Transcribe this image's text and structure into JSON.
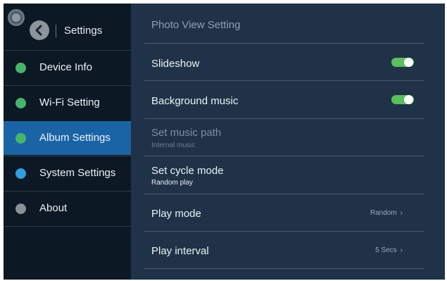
{
  "sidebar": {
    "title": "Settings",
    "items": [
      {
        "label": "Device Info",
        "icon": "info-green-icon",
        "color": "#46b56b",
        "active": false
      },
      {
        "label": "Wi-Fi Setting",
        "icon": "wifi-icon",
        "color": "#46b56b",
        "active": false
      },
      {
        "label": "Album Settings",
        "icon": "album-icon",
        "color": "#46b56b",
        "active": true
      },
      {
        "label": "System Settings",
        "icon": "system-icon",
        "color": "#2f9fe0",
        "active": false
      },
      {
        "label": "About",
        "icon": "about-icon",
        "color": "#8a9096",
        "active": false
      }
    ]
  },
  "main": {
    "title": "Photo View Setting",
    "rows": [
      {
        "label": "Slideshow",
        "type": "toggle",
        "on": true
      },
      {
        "label": "Background music",
        "type": "toggle",
        "on": true
      },
      {
        "label": "Set music path",
        "sub": "Internal music",
        "type": "disabled"
      },
      {
        "label": "Set cycle mode",
        "sub": "Random play",
        "type": "sub"
      },
      {
        "label": "Play mode",
        "value": "Random",
        "type": "value"
      },
      {
        "label": "Play interval",
        "value": "5 Secs",
        "type": "value"
      }
    ]
  },
  "colors": {
    "accent": "#1a64a6",
    "toggle_on": "#5bbf5d",
    "panel": "#1f3247",
    "sidebar": "#0c1824"
  }
}
